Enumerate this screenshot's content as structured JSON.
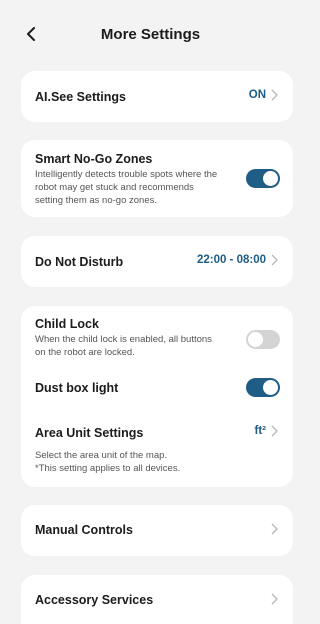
{
  "header": {
    "title": "More Settings"
  },
  "ai_see": {
    "title": "AI.See Settings",
    "value": "ON"
  },
  "smart_zones": {
    "title": "Smart No-Go Zones",
    "desc": [
      "Intelligently detects trouble spots where the",
      "robot may get stuck and recommends",
      "setting them as no-go zones."
    ],
    "enabled": true
  },
  "dnd": {
    "title": "Do Not Disturb",
    "value": "22:00 - 08:00"
  },
  "child_lock": {
    "title": "Child Lock",
    "desc": [
      "When the child lock is enabled, all buttons",
      "on the robot are locked."
    ],
    "enabled": false
  },
  "dust_box": {
    "title": "Dust box light",
    "enabled": true
  },
  "area_unit": {
    "title": "Area Unit Settings",
    "value": "ft²",
    "desc": [
      "Select the area unit of the map.",
      "*This setting applies to all devices."
    ]
  },
  "manual": {
    "title": "Manual Controls"
  },
  "accessory": {
    "title": "Accessory Services"
  },
  "colors": {
    "accent": "#1f5d87",
    "value_text": "#1d5c86",
    "background": "#f3f3f3",
    "toggle_off": "#d4d4d4"
  }
}
